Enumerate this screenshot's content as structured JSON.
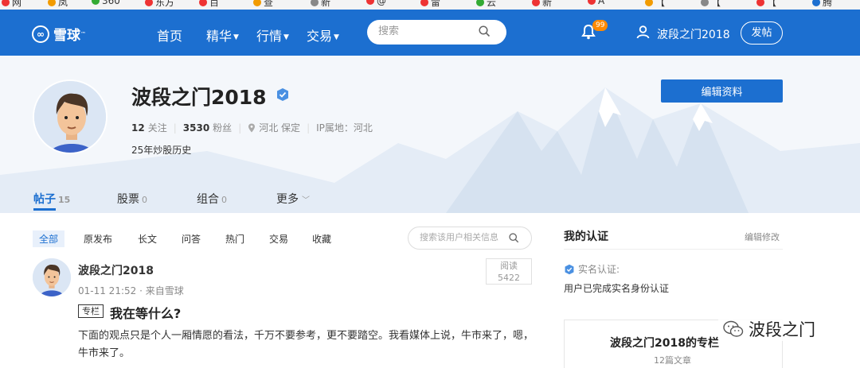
{
  "nav": {
    "logo_text": "雪球",
    "logo_tm": "™",
    "links": [
      "首页",
      "精华",
      "行情",
      "交易"
    ],
    "search_placeholder": "搜索",
    "notification_count": "99",
    "username": "波段之门2018",
    "post_button": "发帖"
  },
  "profile": {
    "name": "波段之门2018",
    "following_count": "12",
    "following_label": "关注",
    "followers_count": "3530",
    "followers_label": "粉丝",
    "location": "河北 保定",
    "ip_label": "IP属地：河北",
    "bio": "25年炒股历史",
    "edit_button": "编辑资料"
  },
  "tabs": [
    {
      "label": "帖子",
      "count": "15"
    },
    {
      "label": "股票",
      "count": "0"
    },
    {
      "label": "组合",
      "count": "0"
    },
    {
      "label": "更多",
      "count": ""
    }
  ],
  "filters": [
    "全部",
    "原发布",
    "长文",
    "问答",
    "热门",
    "交易",
    "收藏"
  ],
  "filter_search_placeholder": "搜索该用户相关信息",
  "post": {
    "author": "波段之门2018",
    "meta": "01-11 21:52 · 来自雪球",
    "read_label": "阅读",
    "read_count": "5422",
    "tag": "专栏",
    "title": "我在等什么?",
    "body": "下面的观点只是个人一厢情愿的看法，千万不要参考，更不要踏空。我看媒体上说，牛市来了，嗯，牛市来了。"
  },
  "certification": {
    "title": "我的认证",
    "edit": "编辑修改",
    "label": "实名认证:",
    "desc": "用户已完成实名身份认证"
  },
  "column": {
    "title": "波段之门2018的专栏",
    "count": "12篇文章"
  },
  "watermark": "波段之门",
  "colors": {
    "brand_blue": "#1c6fd0",
    "badge_orange": "#ff8a00"
  }
}
